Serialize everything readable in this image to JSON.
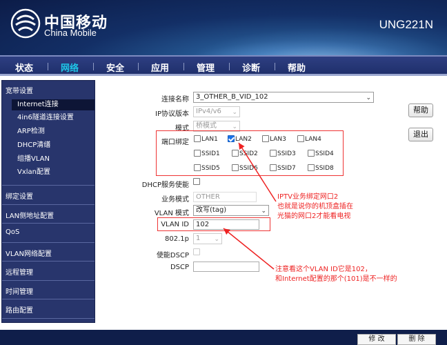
{
  "header": {
    "logo_cn": "中国移动",
    "logo_en": "China Mobile",
    "model": "UNG221N"
  },
  "nav": {
    "items": [
      "状态",
      "网络",
      "安全",
      "应用",
      "管理",
      "诊断",
      "帮助"
    ],
    "active": "网络"
  },
  "sidebar": {
    "broadband": "宽带设置",
    "sub_items": [
      "Internet连接",
      "4in6隧道连接设置",
      "ARP检测",
      "DHCP清缮",
      "组播VLAN",
      "Vxlan配置"
    ],
    "binding": "绑定设置",
    "lan_addr": "LAN侧地址配置",
    "qos": "QoS",
    "vlan_cfg": "VLAN网络配置",
    "remote": "远程管理",
    "time": "时间管理",
    "route": "路由配置"
  },
  "form": {
    "conn_name_label": "连接名称",
    "conn_name_value": "3_OTHER_B_VID_102",
    "ip_version_label": "IP协议版本",
    "ip_version_value": "IPv4/v6",
    "mode_label": "模式",
    "mode_value": "桥模式",
    "port_bind_label": "端口绑定",
    "ports": [
      {
        "label": "LAN1",
        "checked": false
      },
      {
        "label": "LAN2",
        "checked": true
      },
      {
        "label": "LAN3",
        "checked": false
      },
      {
        "label": "LAN4",
        "checked": false
      },
      {
        "label": "SSID1",
        "checked": false
      },
      {
        "label": "SSID2",
        "checked": false
      },
      {
        "label": "SSID3",
        "checked": false
      },
      {
        "label": "SSID4",
        "checked": false
      },
      {
        "label": "SSID5",
        "checked": false
      },
      {
        "label": "SSID6",
        "checked": false
      },
      {
        "label": "SSID7",
        "checked": false
      },
      {
        "label": "SSID8",
        "checked": false
      }
    ],
    "dhcp_label": "DHCP服务使能",
    "service_mode_label": "业务模式",
    "service_mode_value": "OTHER",
    "vlan_mode_label": "VLAN 模式",
    "vlan_mode_value": "改写(tag)",
    "vlan_id_label": "VLAN ID",
    "vlan_id_value": "102",
    "p8021_label": "802.1p",
    "p8021_value": "1",
    "enable_dscp_label": "使能DSCP",
    "dscp_label": "DSCP",
    "dscp_value": ""
  },
  "buttons": {
    "help": "帮助",
    "logout": "退出",
    "modify": "修 改",
    "delete": "删 除"
  },
  "annotations": {
    "note1": [
      "IPTV业务绑定网口2",
      "也就是说你的机顶盒插在",
      "光猫的网口2才能看电视"
    ],
    "note2": [
      "注意看这个VLAN ID它是102，",
      "和Internet配置的那个(101)是不一样的"
    ],
    "color": "#e22222"
  },
  "colors": {
    "nav_bg": "#2a3a7c",
    "nav_active": "#1ec7e8",
    "sidebar_bg": "#28356c"
  }
}
